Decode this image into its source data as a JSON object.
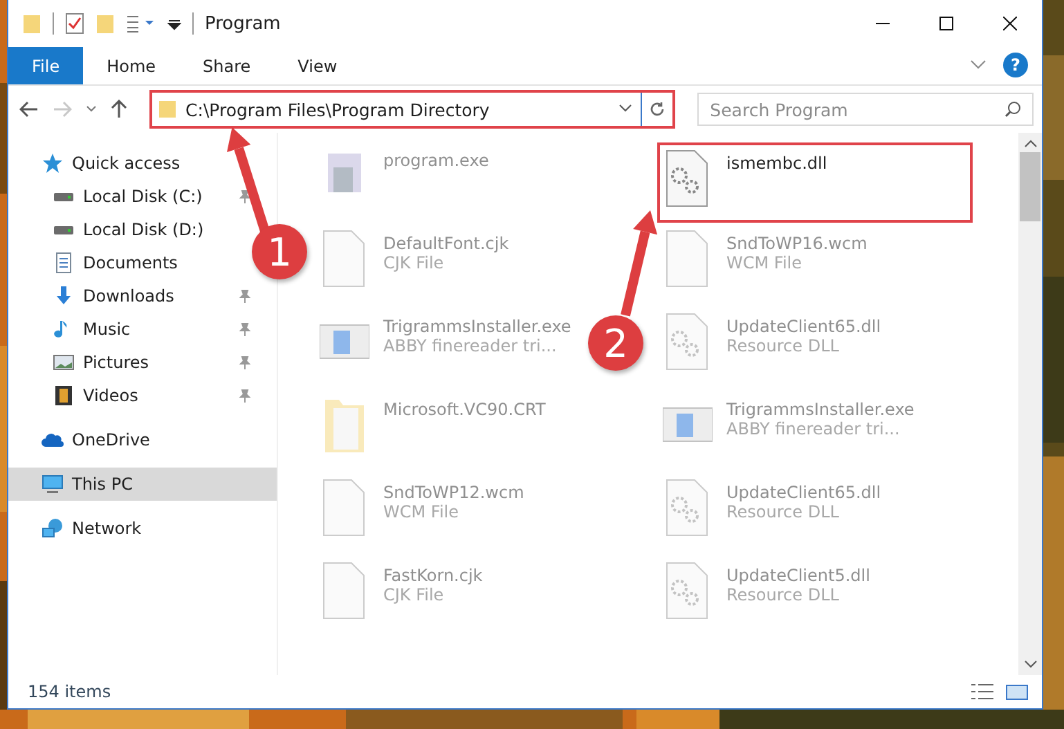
{
  "window": {
    "title": "Program"
  },
  "ribbon": {
    "tabs": [
      {
        "label": "File",
        "kind": "menu"
      },
      {
        "label": "Home",
        "kind": "tab"
      },
      {
        "label": "Share",
        "kind": "tab"
      },
      {
        "label": "View",
        "kind": "tab"
      }
    ],
    "help": "?"
  },
  "address_bar": {
    "path": "C:\\Program Files\\Program Directory",
    "highlighted": true
  },
  "search": {
    "placeholder": "Search Program"
  },
  "sidebar": {
    "items": [
      {
        "label": "Quick access",
        "kind": "star",
        "selected": false,
        "children": [
          {
            "label": "Local Disk (C:)",
            "kind": "disk",
            "pinned": true,
            "selected": false
          },
          {
            "label": "Local Disk (D:)",
            "kind": "disk",
            "pinned": false,
            "selected": false
          },
          {
            "label": "Documents",
            "kind": "documents",
            "pinned": false,
            "selected": false
          },
          {
            "label": "Downloads",
            "kind": "download",
            "pinned": true,
            "selected": false
          },
          {
            "label": "Music",
            "kind": "music",
            "pinned": true,
            "selected": false
          },
          {
            "label": "Pictures",
            "kind": "pictures",
            "pinned": true,
            "selected": false
          },
          {
            "label": "Videos",
            "kind": "videos",
            "pinned": true,
            "selected": false
          }
        ]
      },
      {
        "label": "OneDrive",
        "kind": "cloud",
        "selected": false
      },
      {
        "label": "This PC",
        "kind": "pc",
        "selected": true
      },
      {
        "label": "Network",
        "kind": "network",
        "selected": false
      }
    ]
  },
  "files": [
    {
      "name": "program.exe",
      "kind": "app",
      "faded": true,
      "highlighted": false
    },
    {
      "name": "ismembc.dll",
      "kind": "dll",
      "faded": false,
      "highlighted": true
    },
    {
      "name": "DefaultFont.cjk",
      "type": "CJK File",
      "kind": "blank",
      "faded": true,
      "highlighted": false
    },
    {
      "name": "SndToWP16.wcm",
      "type": "WCM File",
      "kind": "blank",
      "faded": true,
      "highlighted": false
    },
    {
      "name": "TrigrammsInstaller.exe",
      "type": "ABBY finereader tri...",
      "kind": "installer",
      "faded": true,
      "highlighted": false
    },
    {
      "name": "UpdateClient65.dll",
      "type": "Resource DLL",
      "kind": "dll",
      "faded": true,
      "highlighted": false
    },
    {
      "name": "Microsoft.VC90.CRT",
      "kind": "folder",
      "faded": true,
      "highlighted": false
    },
    {
      "name": "TrigrammsInstaller.exe",
      "type": "ABBY finereader tri...",
      "kind": "installer",
      "faded": true,
      "highlighted": false
    },
    {
      "name": "SndToWP12.wcm",
      "type": "WCM File",
      "kind": "blank",
      "faded": true,
      "highlighted": false
    },
    {
      "name": "UpdateClient65.dll",
      "type": "Resource DLL",
      "kind": "dll",
      "faded": true,
      "highlighted": false
    },
    {
      "name": "FastKorn.cjk",
      "type": "CJK File",
      "kind": "blank",
      "faded": true,
      "highlighted": false
    },
    {
      "name": "UpdateClient5.dll",
      "type": "Resource DLL",
      "kind": "dll",
      "faded": true,
      "highlighted": false
    }
  ],
  "status_bar": {
    "count": "154 items"
  },
  "annotations": [
    {
      "label": "1"
    },
    {
      "label": "2"
    }
  ]
}
